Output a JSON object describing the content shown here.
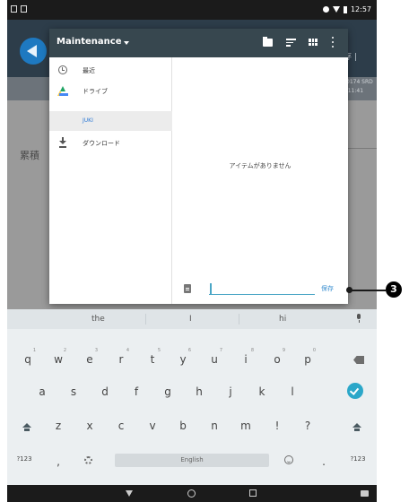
{
  "status_bar": {
    "time": "12:57"
  },
  "background_app": {
    "save_fragment": "存 |",
    "strip_line_1": "0174 SRD",
    "strip_line_2": "8 11:41",
    "label": "累積"
  },
  "dialog": {
    "title": "Maintenance",
    "sidebar": {
      "items": [
        {
          "label": "最近",
          "icon": "clock-icon"
        },
        {
          "label": "ドライブ",
          "icon": "drive-icon"
        },
        {
          "label": "JUKI",
          "icon": "",
          "selected": true
        },
        {
          "label": "ダウンロード",
          "icon": "download-icon"
        }
      ]
    },
    "empty_text": "アイテムがありません",
    "filename_value": "",
    "save_label": "保存"
  },
  "keyboard": {
    "suggestions": [
      "the",
      "I",
      "hi"
    ],
    "row1": [
      {
        "key": "q",
        "hint": "1"
      },
      {
        "key": "w",
        "hint": "2"
      },
      {
        "key": "e",
        "hint": "3"
      },
      {
        "key": "r",
        "hint": "4"
      },
      {
        "key": "t",
        "hint": "5"
      },
      {
        "key": "y",
        "hint": "6"
      },
      {
        "key": "u",
        "hint": "7"
      },
      {
        "key": "i",
        "hint": "8"
      },
      {
        "key": "o",
        "hint": "9"
      },
      {
        "key": "p",
        "hint": "0"
      }
    ],
    "row2": [
      "a",
      "s",
      "d",
      "f",
      "g",
      "h",
      "j",
      "k",
      "l"
    ],
    "row3": [
      "z",
      "x",
      "c",
      "v",
      "b",
      "n",
      "m",
      "!",
      "?"
    ],
    "row4": {
      "symbols": "?123",
      "comma": ",",
      "space": "English",
      "period": ".",
      "symbols_right": "?123"
    }
  },
  "callout": {
    "number": "3"
  },
  "colors": {
    "toolbar": "#37474f",
    "accent": "#2ba7c9",
    "link": "#3a8fd0"
  }
}
